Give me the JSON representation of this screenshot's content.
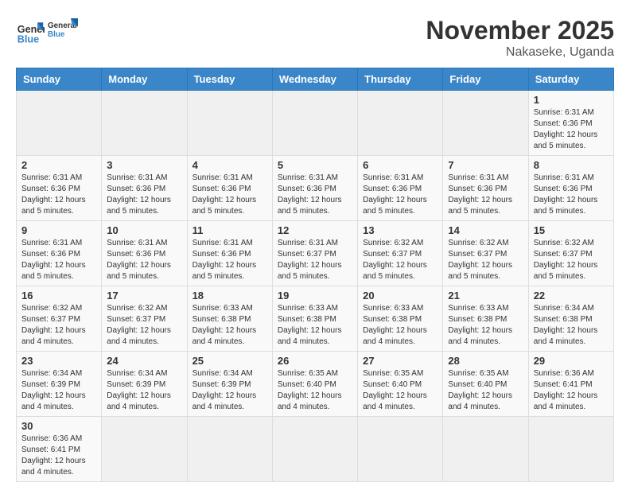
{
  "header": {
    "logo_general": "General",
    "logo_blue": "Blue",
    "month_year": "November 2025",
    "location": "Nakaseke, Uganda"
  },
  "weekdays": [
    "Sunday",
    "Monday",
    "Tuesday",
    "Wednesday",
    "Thursday",
    "Friday",
    "Saturday"
  ],
  "weeks": [
    [
      {
        "day": "",
        "empty": true
      },
      {
        "day": "",
        "empty": true
      },
      {
        "day": "",
        "empty": true
      },
      {
        "day": "",
        "empty": true
      },
      {
        "day": "",
        "empty": true
      },
      {
        "day": "",
        "empty": true
      },
      {
        "day": "1",
        "sunrise": "Sunrise: 6:31 AM",
        "sunset": "Sunset: 6:36 PM",
        "daylight": "Daylight: 12 hours and 5 minutes."
      }
    ],
    [
      {
        "day": "2",
        "sunrise": "Sunrise: 6:31 AM",
        "sunset": "Sunset: 6:36 PM",
        "daylight": "Daylight: 12 hours and 5 minutes."
      },
      {
        "day": "3",
        "sunrise": "Sunrise: 6:31 AM",
        "sunset": "Sunset: 6:36 PM",
        "daylight": "Daylight: 12 hours and 5 minutes."
      },
      {
        "day": "4",
        "sunrise": "Sunrise: 6:31 AM",
        "sunset": "Sunset: 6:36 PM",
        "daylight": "Daylight: 12 hours and 5 minutes."
      },
      {
        "day": "5",
        "sunrise": "Sunrise: 6:31 AM",
        "sunset": "Sunset: 6:36 PM",
        "daylight": "Daylight: 12 hours and 5 minutes."
      },
      {
        "day": "6",
        "sunrise": "Sunrise: 6:31 AM",
        "sunset": "Sunset: 6:36 PM",
        "daylight": "Daylight: 12 hours and 5 minutes."
      },
      {
        "day": "7",
        "sunrise": "Sunrise: 6:31 AM",
        "sunset": "Sunset: 6:36 PM",
        "daylight": "Daylight: 12 hours and 5 minutes."
      },
      {
        "day": "8",
        "sunrise": "Sunrise: 6:31 AM",
        "sunset": "Sunset: 6:36 PM",
        "daylight": "Daylight: 12 hours and 5 minutes."
      }
    ],
    [
      {
        "day": "9",
        "sunrise": "Sunrise: 6:31 AM",
        "sunset": "Sunset: 6:36 PM",
        "daylight": "Daylight: 12 hours and 5 minutes."
      },
      {
        "day": "10",
        "sunrise": "Sunrise: 6:31 AM",
        "sunset": "Sunset: 6:36 PM",
        "daylight": "Daylight: 12 hours and 5 minutes."
      },
      {
        "day": "11",
        "sunrise": "Sunrise: 6:31 AM",
        "sunset": "Sunset: 6:36 PM",
        "daylight": "Daylight: 12 hours and 5 minutes."
      },
      {
        "day": "12",
        "sunrise": "Sunrise: 6:31 AM",
        "sunset": "Sunset: 6:37 PM",
        "daylight": "Daylight: 12 hours and 5 minutes."
      },
      {
        "day": "13",
        "sunrise": "Sunrise: 6:32 AM",
        "sunset": "Sunset: 6:37 PM",
        "daylight": "Daylight: 12 hours and 5 minutes."
      },
      {
        "day": "14",
        "sunrise": "Sunrise: 6:32 AM",
        "sunset": "Sunset: 6:37 PM",
        "daylight": "Daylight: 12 hours and 5 minutes."
      },
      {
        "day": "15",
        "sunrise": "Sunrise: 6:32 AM",
        "sunset": "Sunset: 6:37 PM",
        "daylight": "Daylight: 12 hours and 5 minutes."
      }
    ],
    [
      {
        "day": "16",
        "sunrise": "Sunrise: 6:32 AM",
        "sunset": "Sunset: 6:37 PM",
        "daylight": "Daylight: 12 hours and 4 minutes."
      },
      {
        "day": "17",
        "sunrise": "Sunrise: 6:32 AM",
        "sunset": "Sunset: 6:37 PM",
        "daylight": "Daylight: 12 hours and 4 minutes."
      },
      {
        "day": "18",
        "sunrise": "Sunrise: 6:33 AM",
        "sunset": "Sunset: 6:38 PM",
        "daylight": "Daylight: 12 hours and 4 minutes."
      },
      {
        "day": "19",
        "sunrise": "Sunrise: 6:33 AM",
        "sunset": "Sunset: 6:38 PM",
        "daylight": "Daylight: 12 hours and 4 minutes."
      },
      {
        "day": "20",
        "sunrise": "Sunrise: 6:33 AM",
        "sunset": "Sunset: 6:38 PM",
        "daylight": "Daylight: 12 hours and 4 minutes."
      },
      {
        "day": "21",
        "sunrise": "Sunrise: 6:33 AM",
        "sunset": "Sunset: 6:38 PM",
        "daylight": "Daylight: 12 hours and 4 minutes."
      },
      {
        "day": "22",
        "sunrise": "Sunrise: 6:34 AM",
        "sunset": "Sunset: 6:38 PM",
        "daylight": "Daylight: 12 hours and 4 minutes."
      }
    ],
    [
      {
        "day": "23",
        "sunrise": "Sunrise: 6:34 AM",
        "sunset": "Sunset: 6:39 PM",
        "daylight": "Daylight: 12 hours and 4 minutes."
      },
      {
        "day": "24",
        "sunrise": "Sunrise: 6:34 AM",
        "sunset": "Sunset: 6:39 PM",
        "daylight": "Daylight: 12 hours and 4 minutes."
      },
      {
        "day": "25",
        "sunrise": "Sunrise: 6:34 AM",
        "sunset": "Sunset: 6:39 PM",
        "daylight": "Daylight: 12 hours and 4 minutes."
      },
      {
        "day": "26",
        "sunrise": "Sunrise: 6:35 AM",
        "sunset": "Sunset: 6:40 PM",
        "daylight": "Daylight: 12 hours and 4 minutes."
      },
      {
        "day": "27",
        "sunrise": "Sunrise: 6:35 AM",
        "sunset": "Sunset: 6:40 PM",
        "daylight": "Daylight: 12 hours and 4 minutes."
      },
      {
        "day": "28",
        "sunrise": "Sunrise: 6:35 AM",
        "sunset": "Sunset: 6:40 PM",
        "daylight": "Daylight: 12 hours and 4 minutes."
      },
      {
        "day": "29",
        "sunrise": "Sunrise: 6:36 AM",
        "sunset": "Sunset: 6:41 PM",
        "daylight": "Daylight: 12 hours and 4 minutes."
      }
    ],
    [
      {
        "day": "30",
        "sunrise": "Sunrise: 6:36 AM",
        "sunset": "Sunset: 6:41 PM",
        "daylight": "Daylight: 12 hours and 4 minutes."
      },
      {
        "day": "",
        "empty": true
      },
      {
        "day": "",
        "empty": true
      },
      {
        "day": "",
        "empty": true
      },
      {
        "day": "",
        "empty": true
      },
      {
        "day": "",
        "empty": true
      },
      {
        "day": "",
        "empty": true
      }
    ]
  ]
}
